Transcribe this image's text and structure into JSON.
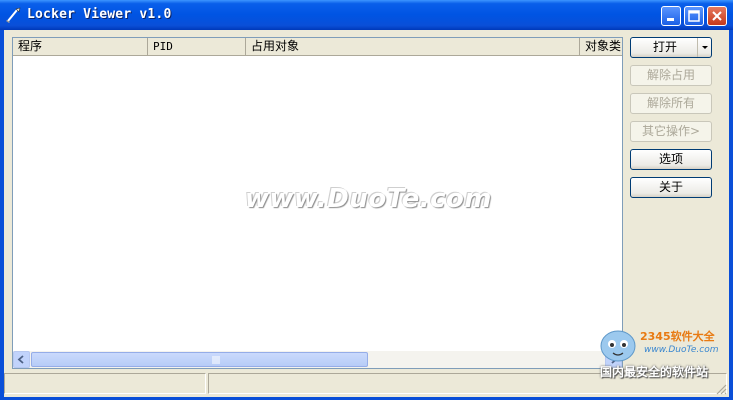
{
  "window": {
    "title": "Locker Viewer v1.0",
    "controls": [
      "minimize-icon",
      "maximize-icon",
      "close-icon"
    ]
  },
  "list": {
    "columns": [
      "程序",
      "PID",
      "占用对象",
      "对象类"
    ]
  },
  "buttons": {
    "open": "打开",
    "unlock": "解除占用",
    "unlock_all": "解除所有",
    "other_ops": "其它操作>",
    "options": "选项",
    "about": "关于"
  },
  "watermark": {
    "text": "www.DuoTe.com"
  },
  "overlay_logo": {
    "brand": "2345软件大全",
    "url": "www.DuoTe.com",
    "slogan": "国内最安全的软件站"
  },
  "colors": {
    "titlebar": "#0054E3",
    "button_border": "#003C74",
    "disabled_text": "#ACA899"
  }
}
